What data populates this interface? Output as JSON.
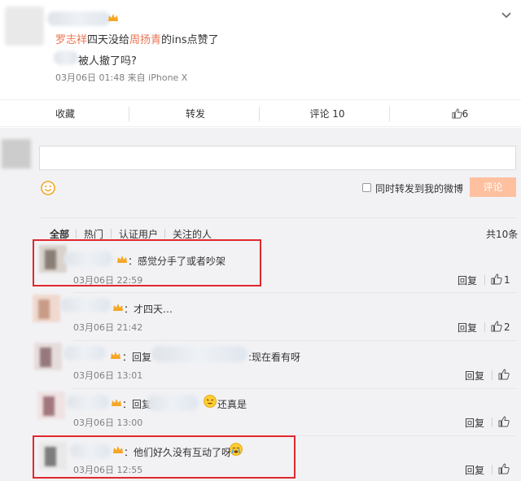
{
  "post": {
    "author_prefix": "罗志祥",
    "text_mid": "四天没给",
    "author_mention": "周扬青",
    "text_end": "的ins点赞了",
    "line2": "被人撤了吗?",
    "meta": "03月06日 01:48  来自 iPhone X"
  },
  "actions": {
    "favorite": "收藏",
    "repost": "转发",
    "comment": "评论 10",
    "like_count": "6"
  },
  "composer": {
    "repost_checkbox_label": "同时转发到我的微博",
    "submit_label": "评论"
  },
  "comment_tabs": [
    "全部",
    "热门",
    "认证用户",
    "关注的人"
  ],
  "total": "共10条",
  "comments": [
    {
      "text": "感觉分手了或者吵架",
      "time": "03月06日 22:59",
      "reply": "回复",
      "likes": "1"
    },
    {
      "text": "才四天…",
      "time": "03月06日 21:42",
      "reply": "回复",
      "likes": "2"
    },
    {
      "prefix": "回复",
      "text": ":现在看有呀",
      "time": "03月06日 13:01",
      "reply": "回复",
      "likes": ""
    },
    {
      "prefix": "回复",
      "text": "还真是",
      "time": "03月06日 13:00",
      "reply": "回复",
      "likes": ""
    },
    {
      "text": "他们好久没有互动了呀",
      "time": "03月06日 12:55",
      "reply": "回复",
      "likes": ""
    }
  ],
  "icons": {
    "expand": "chevron-down-icon",
    "like": "thumbs-up-icon",
    "emoji": "smiley-icon",
    "vip": "crown-icon"
  },
  "colors": {
    "mention": "#eb7350",
    "button": "#ffc09f",
    "highlight_box": "#e0282c"
  }
}
